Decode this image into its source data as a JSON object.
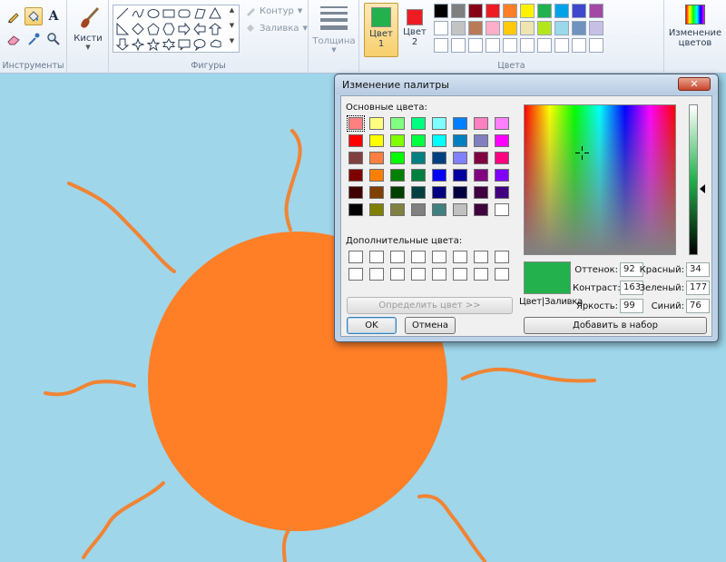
{
  "ribbon": {
    "groups": {
      "tools": "Инструменты",
      "shapes": "Фигуры",
      "colors": "Цвета"
    },
    "brushes_label": "Кисти",
    "outline_label": "Контур",
    "fill_label": "Заливка",
    "thickness_label": "Толщина",
    "color1": {
      "label": "Цвет",
      "number": "1",
      "value": "#22b14c"
    },
    "color2": {
      "label": "Цвет",
      "number": "2",
      "value": "#ed1c24"
    },
    "edit_colors_label": "Изменение цветов",
    "palette_row1": [
      "#000000",
      "#7f7f7f",
      "#880015",
      "#ed1c24",
      "#ff7f27",
      "#fff200",
      "#22b14c",
      "#00a2e8",
      "#3f48cc",
      "#a349a4"
    ],
    "palette_row2": [
      "#ffffff",
      "#c3c3c3",
      "#b97a57",
      "#ffaec9",
      "#ffc90e",
      "#efe4b0",
      "#b5e61d",
      "#99d9ea",
      "#7092be",
      "#c8bfe7"
    ]
  },
  "dialog": {
    "title": "Изменение палитры",
    "close_glyph": "✕",
    "basic_colors_label": "Основные цвета:",
    "custom_colors_label": "Дополнительные цвета:",
    "define_button": "Определить цвет >>",
    "ok_button": "OK",
    "cancel_button": "Отмена",
    "add_button": "Добавить в набор",
    "preview_label": "Цвет|Заливка",
    "preview_color": "#22b14c",
    "hue_label": "Оттенок:",
    "hue": "92",
    "sat_label": "Контраст:",
    "sat": "163",
    "lum_label": "Яркость:",
    "lum": "99",
    "red_label": "Красный:",
    "red": "34",
    "green_label": "Зеленый:",
    "green": "177",
    "blue_label": "Синий:",
    "blue": "76",
    "basic_colors": [
      [
        "#ff8080",
        "#ffff80",
        "#80ff80",
        "#00ff80",
        "#80ffff",
        "#0080ff",
        "#ff80c0",
        "#ff80ff"
      ],
      [
        "#ff0000",
        "#ffff00",
        "#80ff00",
        "#00ff40",
        "#00ffff",
        "#0080c0",
        "#8080c0",
        "#ff00ff"
      ],
      [
        "#804040",
        "#ff8040",
        "#00ff00",
        "#008080",
        "#004080",
        "#8080ff",
        "#800040",
        "#ff0080"
      ],
      [
        "#800000",
        "#ff8000",
        "#008000",
        "#008040",
        "#0000ff",
        "#0000a0",
        "#800080",
        "#8000ff"
      ],
      [
        "#400000",
        "#804000",
        "#004000",
        "#004040",
        "#000080",
        "#000040",
        "#400040",
        "#400080"
      ],
      [
        "#000000",
        "#808000",
        "#808040",
        "#808080",
        "#408080",
        "#c0c0c0",
        "#400040",
        "#ffffff"
      ]
    ]
  }
}
